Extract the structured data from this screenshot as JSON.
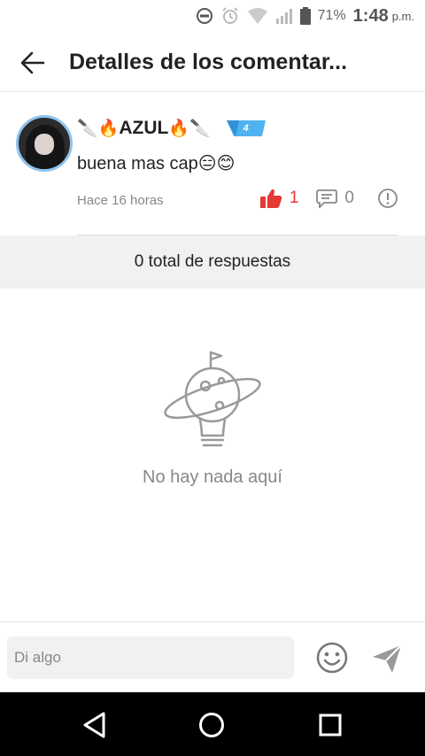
{
  "status_bar": {
    "battery_percent": "71%",
    "time": "1:48",
    "ampm": "p.m."
  },
  "header": {
    "title": "Detalles de los comentar..."
  },
  "comment": {
    "username": "AZUL",
    "level": "4",
    "text": "buena mas cap",
    "text_emojis": "😑😊",
    "time": "Hace 16 horas",
    "likes": "1",
    "replies": "0"
  },
  "replies_header": {
    "label": "0 total de respuestas"
  },
  "empty_state": {
    "message": "No hay nada aquí"
  },
  "composer": {
    "placeholder": "Di algo"
  },
  "colors": {
    "accent_red": "#e53935",
    "level_blue": "#4fb3f0",
    "divider_gray": "#f1f1f1"
  }
}
